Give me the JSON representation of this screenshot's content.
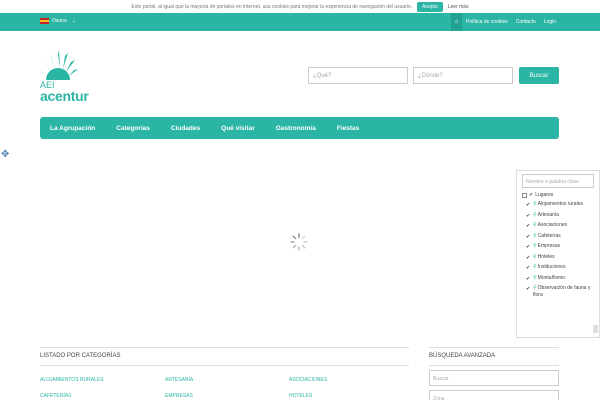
{
  "cookie": {
    "message": "Este portal, al igual que la mayoría de portales en Internet, usa cookies para mejorar la experiencia de navegación del usuario.",
    "accept": "Acepto",
    "more": "Leer más"
  },
  "topbar": {
    "language": "Osuna",
    "links": [
      "Política de cookies",
      "Contacto",
      "Login"
    ]
  },
  "logo": {
    "prefix": "AEI",
    "name": "acentur"
  },
  "search": {
    "what_placeholder": "¿Qué?",
    "where_placeholder": "¿Dónde?",
    "button": "Buscar"
  },
  "nav": [
    "La Agrupación",
    "Categorías",
    "Ciudades",
    "Qué visitar",
    "Gastronomía",
    "Fiestas"
  ],
  "map": {
    "keyword_placeholder": "Nombre o palabra clave",
    "root": "Lugares",
    "items": [
      "Alojamientos rurales",
      "Artesanía",
      "Asociaciones",
      "Cafeterías",
      "Empresas",
      "Hoteles",
      "Instituciones",
      "Montañismo",
      "Observación de fauna y flora"
    ]
  },
  "categories": {
    "title": "LISTADO POR CATEGORÍAS",
    "items": [
      "ALOJAMIENTOS RURALES",
      "ARTESANÍA",
      "ASOCIACIONES",
      "CAFETERÍAS",
      "EMPRESAS",
      "HOTELES"
    ]
  },
  "advanced": {
    "title": "BÚSQUEDA AVANZADA",
    "search_placeholder": "Buscar",
    "second_placeholder": "Zona"
  },
  "colors": {
    "accent": "#2bb5a5"
  }
}
